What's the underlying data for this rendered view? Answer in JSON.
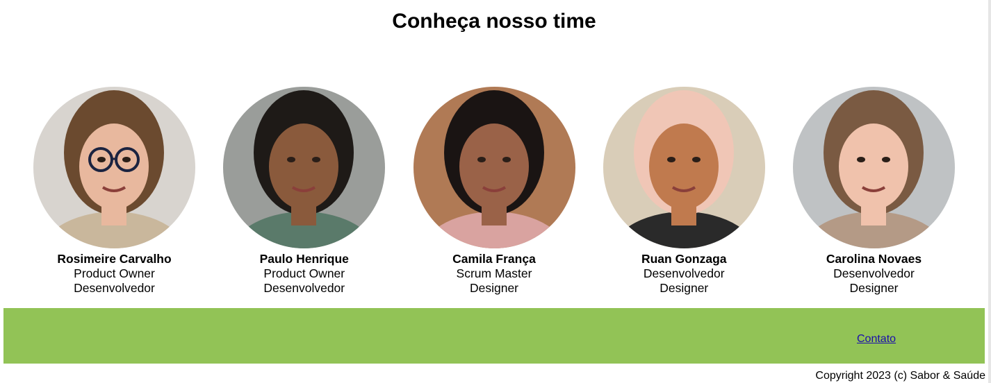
{
  "page": {
    "title": "Conheça nosso time"
  },
  "team": [
    {
      "name": "Rosimeire Carvalho",
      "role1": "Product Owner",
      "role2": "Desenvolvedor",
      "photo": {
        "bg": "#d8d4cf",
        "hair": "#6b4a2f",
        "skin": "#e8b89e",
        "shirt": "#c9b79c",
        "glasses": true
      }
    },
    {
      "name": "Paulo Henrique",
      "role1": "Product Owner",
      "role2": "Desenvolvedor",
      "photo": {
        "bg": "#9a9d9a",
        "hair": "#1e1a17",
        "skin": "#8a5a3c",
        "shirt": "#5a7a6a",
        "glasses": false
      }
    },
    {
      "name": "Camila França",
      "role1": "Scrum Master",
      "role2": "Designer",
      "photo": {
        "bg": "#b07a55",
        "hair": "#1a1413",
        "skin": "#9a6248",
        "shirt": "#d9a3a0",
        "glasses": false
      }
    },
    {
      "name": "Ruan Gonzaga",
      "role1": "Desenvolvedor",
      "role2": "Designer",
      "photo": {
        "bg": "#d9cdb8",
        "hair": "#f0c6b6",
        "skin": "#c07a4e",
        "shirt": "#2a2a2a",
        "glasses": false
      }
    },
    {
      "name": "Carolina Novaes",
      "role1": "Desenvolvedor",
      "role2": "Designer",
      "photo": {
        "bg": "#bfc2c4",
        "hair": "#7a5a42",
        "skin": "#f0c2ac",
        "shirt": "#b49a86",
        "glasses": false
      }
    }
  ],
  "footer": {
    "contact_label": "Contato",
    "background": "#92c356",
    "copyright": "Copyright 2023 (c) Sabor & Saúde"
  }
}
